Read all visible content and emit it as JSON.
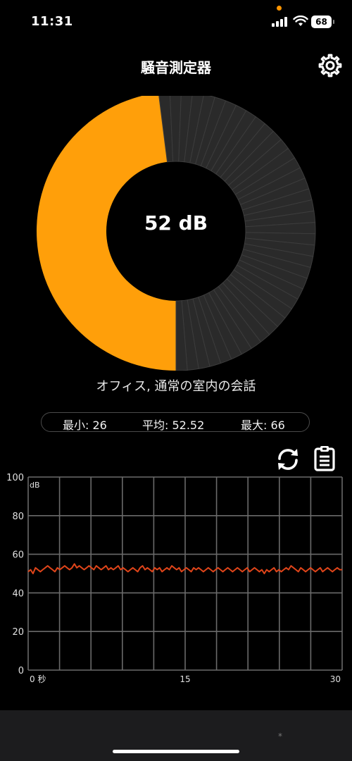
{
  "status": {
    "time": "11:31",
    "battery": "68"
  },
  "header": {
    "title": "騒音測定器",
    "settings_icon": "gear-icon"
  },
  "gauge": {
    "value_text": "52 dB",
    "fraction": 0.48,
    "colors": {
      "active": "#ff9f0a",
      "inactive": "#2a2a2a",
      "divider": "#3c3c3c"
    }
  },
  "description": "オフィス, 通常の室内の会話",
  "stats": {
    "min": "最小: 26",
    "avg": "平均: 52.52",
    "max": "最大: 66"
  },
  "actions": {
    "refresh_icon": "refresh-icon",
    "clipboard_icon": "clipboard-icon"
  },
  "bottom_mark": "*",
  "chart_data": {
    "type": "line",
    "title": "",
    "xlabel": "",
    "ylabel": "dB",
    "xlim": [
      0,
      30
    ],
    "ylim": [
      0,
      100
    ],
    "x_tick_labels": [
      "0 秒",
      "15",
      "30"
    ],
    "y_ticks": [
      0,
      20,
      40,
      60,
      80,
      100
    ],
    "grid": true,
    "line_color": "#e0451a",
    "series": [
      {
        "values": [
          51,
          52,
          50,
          53,
          52,
          51,
          52,
          53,
          54,
          53,
          52,
          51,
          53,
          52,
          53,
          54,
          53,
          52,
          53,
          55,
          53,
          54,
          53,
          52,
          53,
          54,
          53,
          52,
          54,
          53,
          52,
          53,
          54,
          52,
          53,
          52,
          53,
          54,
          52,
          53,
          52,
          51,
          52,
          53,
          52,
          51,
          53,
          54,
          52,
          53,
          52,
          51,
          53,
          52,
          53,
          51,
          52,
          53,
          52,
          54,
          53,
          52,
          53,
          51,
          52,
          53,
          52,
          51,
          53,
          52,
          53,
          52,
          51,
          52,
          53,
          52,
          51,
          52,
          53,
          52,
          51,
          52,
          53,
          52,
          51,
          52,
          53,
          52,
          51,
          52,
          53,
          51,
          52,
          53,
          52,
          51,
          52,
          50,
          52,
          51,
          52,
          53,
          51,
          52,
          51,
          52,
          53,
          52,
          54,
          53,
          52,
          51,
          53,
          52,
          51,
          52,
          53,
          52,
          51,
          52,
          53,
          51,
          52,
          53,
          52,
          51,
          52,
          53,
          52,
          52
        ]
      }
    ]
  }
}
